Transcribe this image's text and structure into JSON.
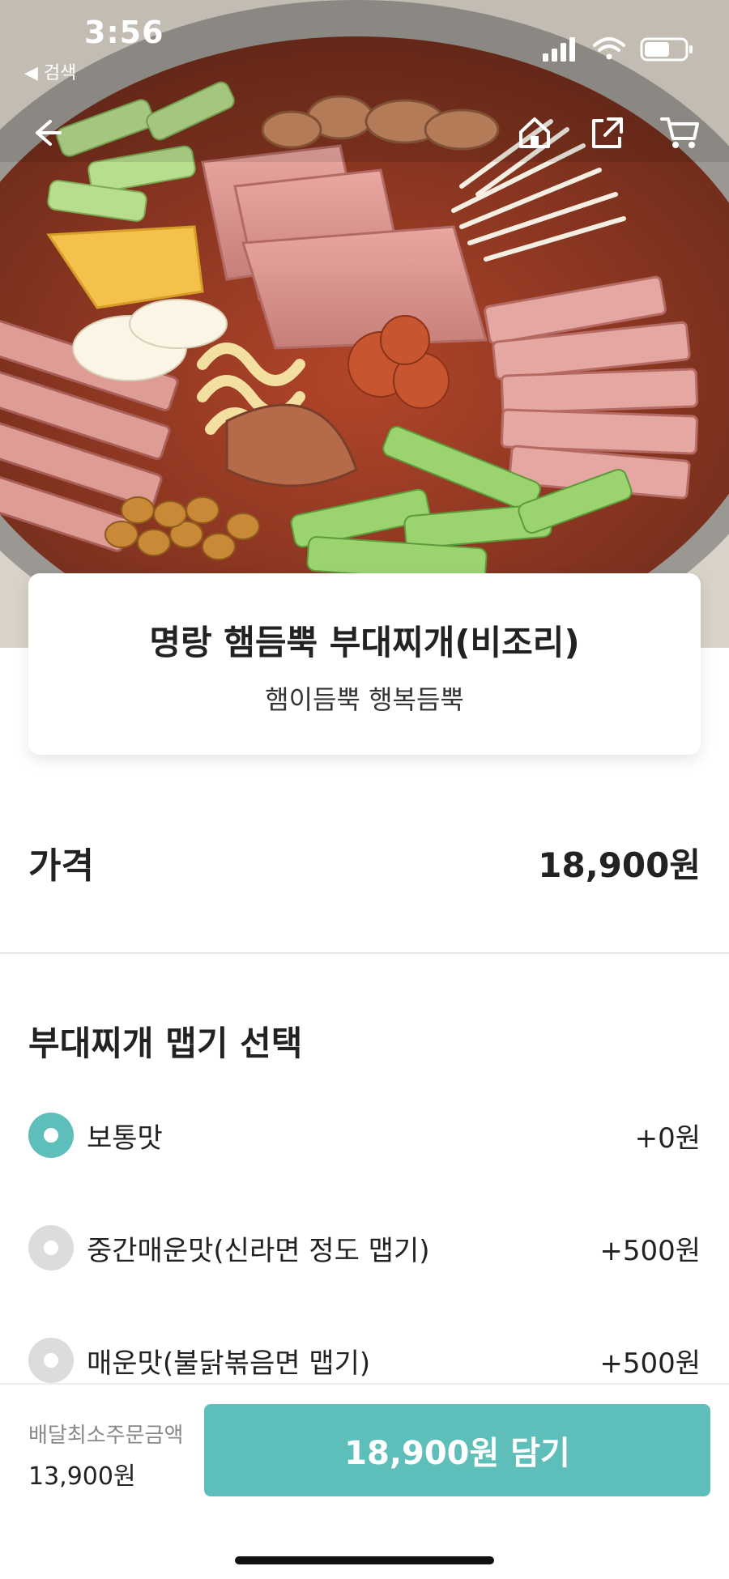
{
  "status_bar": {
    "time": "3:56",
    "back_label": "◀ 검색"
  },
  "top_nav": {
    "icons": [
      "back-arrow-icon",
      "home-icon",
      "share-icon",
      "cart-icon"
    ]
  },
  "product": {
    "name": "명랑 햄듬뿍 부대찌개(비조리)",
    "subtitle": "햄이듬뿍 행복듬뿍"
  },
  "price": {
    "label": "가격",
    "value": "18,900원"
  },
  "options": {
    "title": "부대찌개 맵기 선택",
    "items": [
      {
        "label": "보통맛",
        "price": "+0원",
        "selected": true
      },
      {
        "label": "중간매운맛(신라면 정도 맵기)",
        "price": "+500원",
        "selected": false
      },
      {
        "label": "매운맛(불닭볶음면 맵기)",
        "price": "+500원",
        "selected": false
      }
    ]
  },
  "bottom_bar": {
    "min_order_label": "배달최소주문금액",
    "min_order_value": "13,900원",
    "add_button_label": "18,900원 담기"
  },
  "colors": {
    "accent": "#5ebfba",
    "radio_unselected": "#dcdcdc"
  }
}
